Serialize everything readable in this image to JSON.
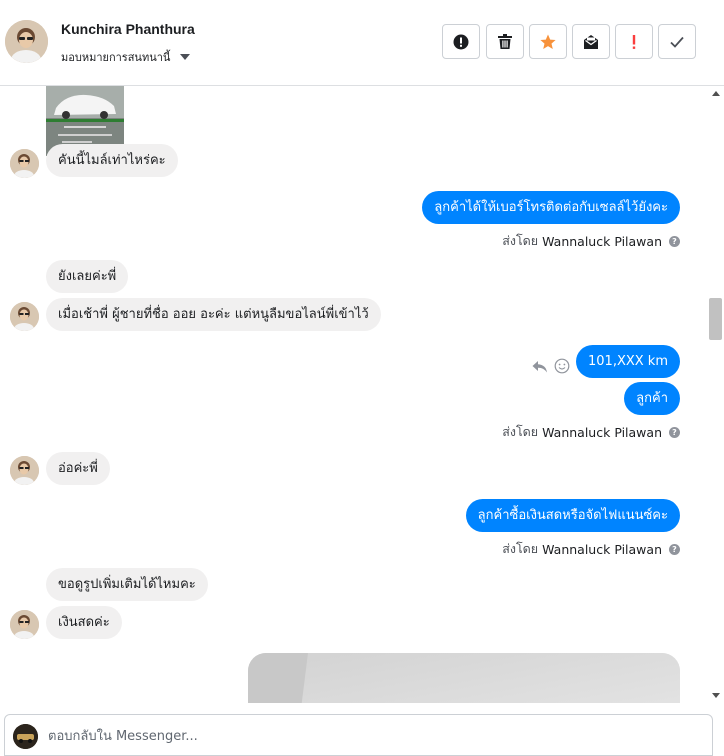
{
  "header": {
    "contact_name": "Kunchira Phanthura",
    "assign_label": "มอบหมายการสนทนานี้",
    "toolbar": [
      {
        "name": "mark-spam-button",
        "icon": "alert-circle-icon"
      },
      {
        "name": "delete-button",
        "icon": "trash-icon"
      },
      {
        "name": "star-button",
        "icon": "star-icon",
        "color": "#f7923b"
      },
      {
        "name": "mark-unread-button",
        "icon": "envelope-icon"
      },
      {
        "name": "important-button",
        "icon": "exclamation-icon",
        "color": "#fa3e3e"
      },
      {
        "name": "mark-done-button",
        "icon": "check-icon"
      }
    ]
  },
  "messages": {
    "m1": "คันนี้ไมล์เท่าไหร่คะ",
    "m2": "ลูกค้าได้ให้เบอร์โทรติดต่อกับเซลล์ไว้ยังคะ",
    "m3": "ยังเลยค่ะพี่",
    "m4": "เมื่อเช้าพี่ ผู้ชายที่ชื่อ ออย อะค่ะ แต่หนูลืมขอไลน์พี่เข้าไว้",
    "m5": "101,XXX  km",
    "m6": "ลูกค้า",
    "m7": "อ่อค่ะพี่",
    "m8": "ลูกค้าซื้อเงินสดหรือจัดไฟแนนซ์คะ",
    "m9": "ขอดูรูปเพิ่มเติมได้ไหมคะ",
    "m10": "เงินสดค่ะ"
  },
  "sent_by": {
    "prefix": "ส่งโดย",
    "sender": "Wannaluck Pilawan"
  },
  "composer": {
    "placeholder": "ตอบกลับใน Messenger..."
  },
  "colors": {
    "outgoing": "#0084ff",
    "incoming": "#f1f0f0"
  }
}
